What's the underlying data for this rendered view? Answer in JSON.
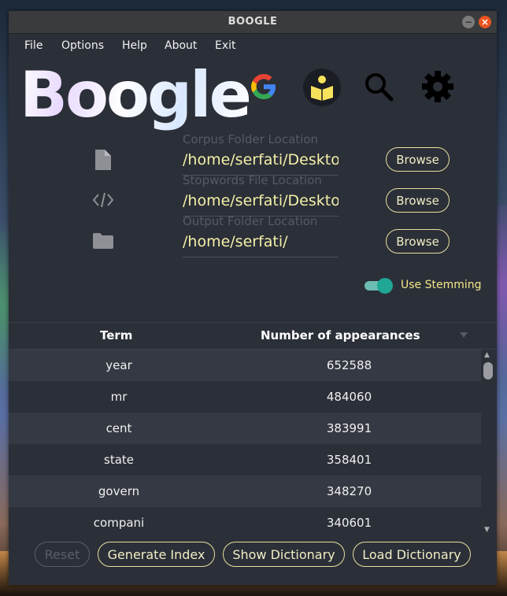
{
  "window": {
    "title": "BOOGLE",
    "minimize_glyph": "−",
    "close_glyph": "×"
  },
  "menu": [
    "File",
    "Options",
    "Help",
    "About",
    "Exit"
  ],
  "logo": {
    "text": "Boogle"
  },
  "toolbar_icons": [
    "google-icon",
    "reader-icon",
    "search-icon",
    "settings-icon"
  ],
  "fields": [
    {
      "icon": "file-icon",
      "label": "Corpus Folder Location",
      "value": "/home/serfati/Desktop",
      "button": "Browse"
    },
    {
      "icon": "code-icon",
      "label": "Stopwords File Location",
      "value": "/home/serfati/Desktop",
      "button": "Browse"
    },
    {
      "icon": "folder-icon",
      "label": "Output Folder Location",
      "value": "/home/serfati/",
      "button": "Browse"
    }
  ],
  "stemming": {
    "label": "Use Stemming",
    "enabled": true
  },
  "table": {
    "columns": [
      "Term",
      "Number of appearances"
    ],
    "rows": [
      [
        "year",
        "652588"
      ],
      [
        "mr",
        "484060"
      ],
      [
        "cent",
        "383991"
      ],
      [
        "state",
        "358401"
      ],
      [
        "govern",
        "348270"
      ],
      [
        "compani",
        "340601"
      ]
    ]
  },
  "buttons": {
    "reset": "Reset",
    "generate": "Generate Index",
    "show": "Show Dictionary",
    "load": "Load Dictionary"
  },
  "colors": {
    "accent": "#f4f0a8",
    "toggle": "#1fa695",
    "google_blue": "#4285f4"
  }
}
